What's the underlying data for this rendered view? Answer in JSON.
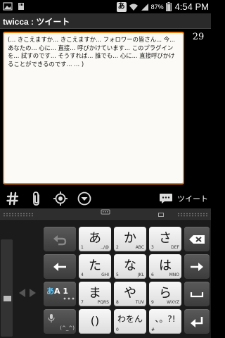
{
  "status_bar": {
    "icons": [
      "picture-icon",
      "sd-card-icon",
      "ime-indicator-icon",
      "wifi-icon",
      "signal-icon",
      "battery-icon"
    ],
    "ime_indicator": "あ",
    "battery": "87%",
    "time": "4:54 PM"
  },
  "app": {
    "title": "twicca : ツイート"
  },
  "compose": {
    "text": "(... きこえますか... きこえますか... フォロワーの皆さん... 今... あなたの... 心に... 直接... 呼びかけています... このプラグインを... 試すのです... そうすれば... 誰でも... 心に... 直接呼びかけることができるのです... ... )",
    "char_count": "29"
  },
  "toolbar": {
    "tools": [
      "hashtag-icon",
      "attach-icon",
      "location-icon",
      "more-icon"
    ],
    "tweet_label": "ツイート"
  },
  "keyboard": {
    "rows": [
      [
        {
          "main": "あ",
          "num": "1",
          "sub": ".,/@"
        },
        {
          "main": "か",
          "num": "2",
          "sub": "ABC"
        },
        {
          "main": "さ",
          "num": "3",
          "sub": "DEF"
        }
      ],
      [
        {
          "main": "た",
          "num": "4",
          "sub": "GHI"
        },
        {
          "main": "な",
          "num": "5",
          "sub": "JKL"
        },
        {
          "main": "は",
          "num": "6",
          "sub": "MNO"
        }
      ],
      [
        {
          "main": "ま",
          "num": "7",
          "sub": "PQRS"
        },
        {
          "main": "や",
          "num": "8",
          "sub": "TUV"
        },
        {
          "main": "ら",
          "num": "9",
          "sub": "WXYZ"
        }
      ],
      [
        {
          "main": "()",
          "num": "",
          "sub": ""
        },
        {
          "main": "わをん",
          "num": "0",
          "sub": ""
        },
        {
          "main": "、。?!",
          "num": "#",
          "sub": ""
        }
      ]
    ],
    "mode_kana": "あ",
    "mode_alpha": "A 1",
    "emoji_label": "(^_^)"
  },
  "colors": {
    "accent": "#f07a10",
    "compose_bg": "#fbfaf6",
    "key_light": "#eeeeee",
    "key_dark": "#4a4a4a"
  }
}
